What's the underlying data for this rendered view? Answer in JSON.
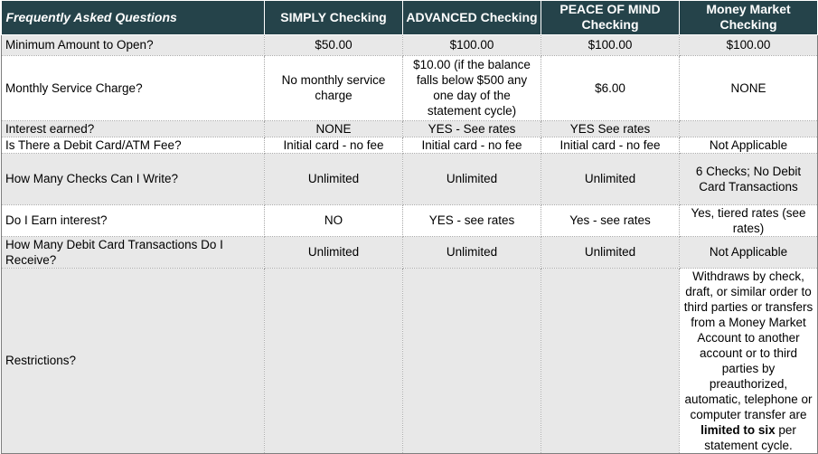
{
  "header": {
    "question_col": "Frequently Asked Questions",
    "simply": "SIMPLY Checking",
    "advanced": "ADVANCED Checking",
    "peace_line1": "PEACE OF MIND",
    "peace_line2": "Checking",
    "mm_line1": "Money Market",
    "mm_line2": "Checking"
  },
  "rows": [
    {
      "question": "Minimum Amount to Open?",
      "simply": "$50.00",
      "advanced": "$100.00",
      "peace": "$100.00",
      "mm": "$100.00"
    },
    {
      "question": "Monthly Service Charge?",
      "simply": "No monthly service charge",
      "advanced": "$10.00 (if the balance falls below $500 any one day of the statement cycle)",
      "peace": "$6.00",
      "mm": "NONE"
    },
    {
      "question": "Interest earned?",
      "simply": "NONE",
      "advanced": "YES - See rates",
      "peace": "YES See rates",
      "mm": ""
    },
    {
      "question": "Is There a Debit Card/ATM Fee?",
      "simply": "Initial card - no fee",
      "advanced": "Initial card - no fee",
      "peace": "Initial card - no fee",
      "mm": "Not Applicable"
    },
    {
      "question": "How Many Checks Can I Write?",
      "simply": "Unlimited",
      "advanced": "Unlimited",
      "peace": "Unlimited",
      "mm": "6 Checks; No Debit Card Transactions"
    },
    {
      "question": "Do I Earn interest?",
      "simply": "NO",
      "advanced": "YES - see rates",
      "peace": "Yes - see rates",
      "mm": "Yes, tiered rates (see rates)"
    },
    {
      "question": "How Many Debit Card Transactions Do I Receive?",
      "simply": "Unlimited",
      "advanced": "Unlimited",
      "peace": "Unlimited",
      "mm": "Not Applicable"
    },
    {
      "question": "Restrictions?",
      "simply": "",
      "advanced": "",
      "peace": "",
      "mm_pre": "Withdraws by check, draft, or similar order to third parties or transfers from a Money Market Account to another account or to third parties by preauthorized, automatic, telephone or computer transfer are",
      "mm_bold": "limited to six",
      "mm_post": "per statement cycle."
    }
  ]
}
